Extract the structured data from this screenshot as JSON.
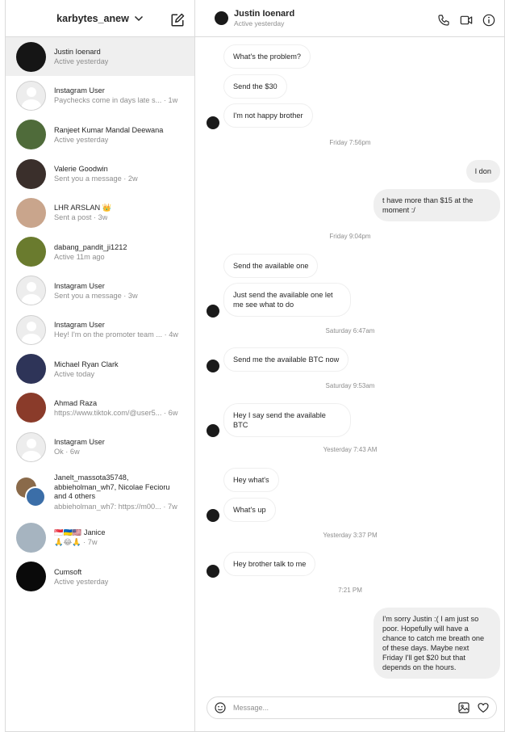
{
  "sidebar": {
    "account": "karbytes_anew",
    "threads": [
      {
        "name": "Justin Ioenard",
        "sub": "Active yesterday",
        "time": "",
        "avatar_color": "#151515",
        "active": true
      },
      {
        "name": "Instagram User",
        "sub": "Paychecks come in days late s...",
        "time": "· 1w",
        "avatar_color": "",
        "active": false
      },
      {
        "name": "Ranjeet Kumar Mandal Deewana",
        "sub": "Active yesterday",
        "time": "",
        "avatar_color": "#4f6b3a",
        "active": false
      },
      {
        "name": "Valerie Goodwin",
        "sub": "Sent you a message · 2w",
        "time": "",
        "avatar_color": "#3a2f2b",
        "active": false
      },
      {
        "name": "LHR ARSLAN 👑",
        "sub": "Sent a post · 3w",
        "time": "",
        "avatar_color": "#c9a58c",
        "active": false
      },
      {
        "name": "dabang_pandit_ji1212",
        "sub": "Active 11m ago",
        "time": "",
        "avatar_color": "#6a7b2e",
        "active": false
      },
      {
        "name": "Instagram User",
        "sub": "Sent you a message · 3w",
        "time": "",
        "avatar_color": "",
        "active": false
      },
      {
        "name": "Instagram User",
        "sub": "Hey! I'm on the promoter team ...",
        "time": "· 4w",
        "avatar_color": "",
        "active": false
      },
      {
        "name": "Michael Ryan Clark",
        "sub": "Active today",
        "time": "",
        "avatar_color": "#2e3458",
        "active": false
      },
      {
        "name": "Ahmad Raza",
        "sub": "https://www.tiktok.com/@user5...",
        "time": "· 6w",
        "avatar_color": "#8a3b2a",
        "active": false
      },
      {
        "name": "Instagram User",
        "sub": "Ok · 6w",
        "time": "",
        "avatar_color": "",
        "active": false
      }
    ],
    "group": {
      "name": "Janelt_massota35748, abbieholman_wh7, Nicolae Fecioru and 4 others",
      "sub": "abbieholman_wh7: https://m00...",
      "time": "· 7w"
    },
    "janice": {
      "name": "🇸🇬🇺🇦🇺🇸 Janice",
      "sub": "🙏😂🙏 · 7w",
      "avatar_color": "#a6b4c0"
    },
    "cumsoft": {
      "name": "Cumsoft",
      "sub": "Active yesterday",
      "avatar_color": "#0a0a0a"
    }
  },
  "chat": {
    "name": "Justin Ioenard",
    "status": "Active yesterday",
    "composer_placeholder": "Message...",
    "messages": [
      {
        "id": "m1",
        "dir": "in",
        "text": "What's the problem?"
      },
      {
        "id": "m2",
        "dir": "in",
        "text": "Send the $30"
      },
      {
        "id": "m3",
        "dir": "in",
        "text": "I'm not happy brother"
      },
      {
        "id": "m4",
        "dir": "out",
        "text": "I don"
      },
      {
        "id": "m5",
        "dir": "out",
        "text": "t have more than $15 at the moment :/"
      },
      {
        "id": "m6",
        "dir": "in",
        "text": "Send the available one"
      },
      {
        "id": "m7",
        "dir": "in",
        "text": "Just send the available one let me see what to do"
      },
      {
        "id": "m8",
        "dir": "in",
        "text": "Send me the available BTC now"
      },
      {
        "id": "m9",
        "dir": "in",
        "text": "Hey I say send the available BTC"
      },
      {
        "id": "m10",
        "dir": "in",
        "text": "Hey what's"
      },
      {
        "id": "m11",
        "dir": "in",
        "text": "What's up"
      },
      {
        "id": "m12",
        "dir": "in",
        "text": "Hey brother talk to me"
      },
      {
        "id": "m13",
        "dir": "out",
        "text": "I'm sorry Justin :( I am just so poor. Hopefully will have a chance to catch me breath one of these days. Maybe next Friday I'll get $20 but that depends on the hours."
      }
    ],
    "timestamps": [
      "Friday 7:56pm",
      "Friday 9:04pm",
      "Saturday 6:47am",
      "Saturday 9:53am",
      "Yesterday 7:43 AM",
      "Yesterday 3:37 PM",
      "7:21 PM"
    ]
  }
}
